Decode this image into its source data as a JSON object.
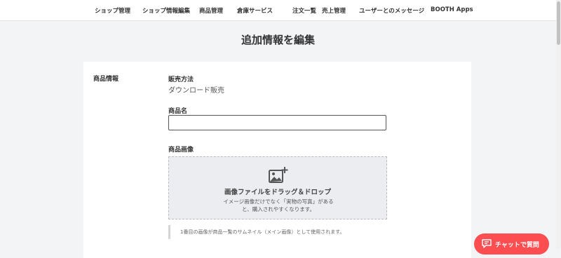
{
  "colors": {
    "brand": "#fc4d50",
    "page_bg": "#f3f4f6",
    "card_bg": "#ffffff",
    "dropzone_bg": "#ebedf0"
  },
  "nav": {
    "items": [
      {
        "label": "ショップ管理"
      },
      {
        "label": "ショップ情報編集"
      },
      {
        "label": "商品管理"
      },
      {
        "label": "倉庫サービス"
      },
      {
        "label": "注文一覧"
      },
      {
        "label": "売上管理"
      },
      {
        "label": "ユーザーとのメッセージ"
      },
      {
        "label": "BOOTH Apps"
      }
    ]
  },
  "page": {
    "title": "追加情報を編集"
  },
  "form": {
    "section_label": "商品情報",
    "sales_method": {
      "label": "販売方法",
      "value": "ダウンロード販売"
    },
    "product_name": {
      "label": "商品名",
      "value": "",
      "placeholder": ""
    },
    "product_image": {
      "label": "商品画像",
      "icon": "image-add-icon",
      "dropzone_title": "画像ファイルをドラッグ＆ドロップ",
      "dropzone_desc": "イメージ画像だけでなく「実物の写真」があると、購入されやすくなります。",
      "note": "1番目の画像が商品一覧のサムネイル（メイン画像）として使用されます。"
    }
  },
  "chat": {
    "icon": "chat-bubble-icon",
    "label": "チャットで質問"
  }
}
